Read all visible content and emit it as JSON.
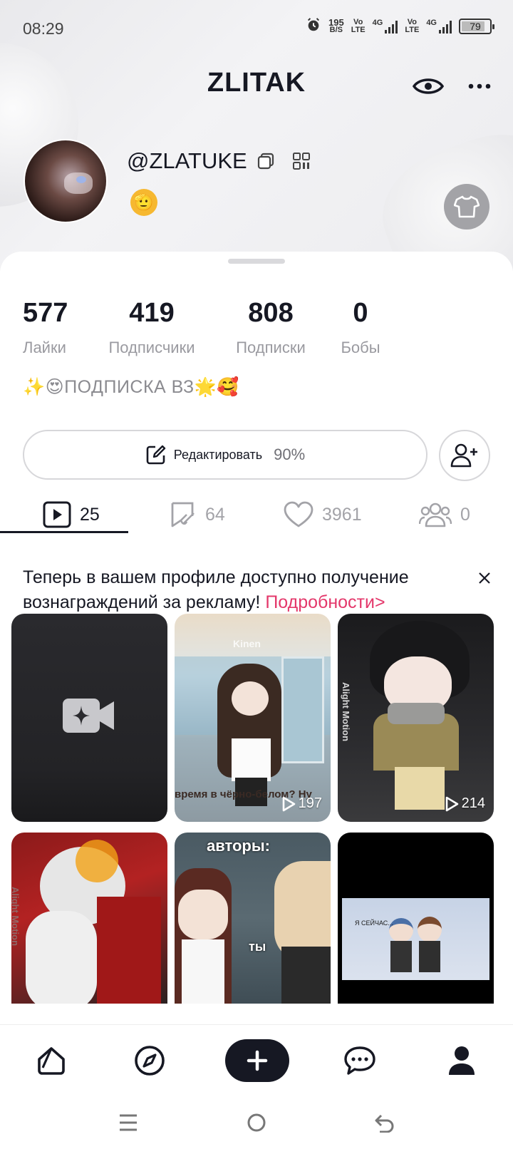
{
  "status_bar": {
    "time": "08:29",
    "net_speed": "195",
    "net_unit": "B/S",
    "sim1_top": "Vo",
    "sim1_bottom": "LTE",
    "sim1_gen": "4G",
    "sim2_top": "Vo",
    "sim2_bottom": "LTE",
    "sim2_gen": "4G",
    "battery": "79"
  },
  "header": {
    "title": "ZLITAK"
  },
  "profile": {
    "username": "@ZLATUKE",
    "emoji": "🫡"
  },
  "stats": [
    {
      "value": "577",
      "label": "Лайки"
    },
    {
      "value": "419",
      "label": "Подписчики"
    },
    {
      "value": "808",
      "label": "Подписки"
    },
    {
      "value": "0",
      "label": "Бобы"
    }
  ],
  "bio": "✨😍ПОДПИСКА ВЗ🌟🥰",
  "edit_button": {
    "label": "Редактировать",
    "percent": "90%"
  },
  "tabs": [
    {
      "name": "videos",
      "count": "25"
    },
    {
      "name": "reposts",
      "count": "64"
    },
    {
      "name": "likes",
      "count": "3961"
    },
    {
      "name": "friends",
      "count": "0"
    }
  ],
  "promo": {
    "text": "Теперь в вашем профиле доступно получение вознаграждений за рекламу! ",
    "link": "Подробности>"
  },
  "videos": [
    {
      "type": "create",
      "count": ""
    },
    {
      "type": "video",
      "count": "197",
      "watermark": "Kinen",
      "caption": "время в чёрно-белом? Ну"
    },
    {
      "type": "video",
      "count": "214",
      "watermark": "Alight Motion"
    },
    {
      "type": "video",
      "count": "",
      "watermark": "Alight Motion"
    },
    {
      "type": "video",
      "count": "",
      "caption_top": "авторы:",
      "caption_mid": "ты"
    },
    {
      "type": "video",
      "count": "",
      "caption": "Я СЕЙЧАС..."
    }
  ],
  "colors": {
    "accent_link": "#e4386b",
    "primary_text": "#161823",
    "muted_text": "#9a9aa0"
  }
}
